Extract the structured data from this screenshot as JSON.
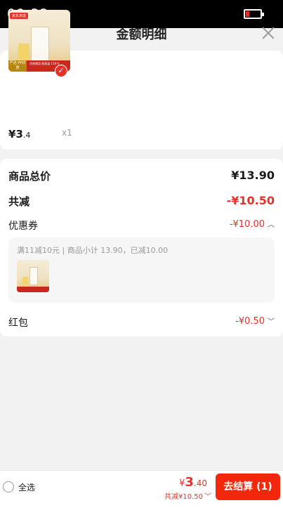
{
  "status_bar": {
    "time": "09:32"
  },
  "header": {
    "title": "金额明细"
  },
  "product": {
    "thumb_tag": "京东京造",
    "thumb_badge_left": "严选 PP材质",
    "thumb_badge_right": "冷热两用 耐高温 110℃",
    "price_symbol": "¥",
    "price_int": "3",
    "price_dec": ".4",
    "quantity": "x1"
  },
  "summary": {
    "total_label": "商品总价",
    "total_value": "¥13.90",
    "reduce_label": "共减",
    "reduce_value": "-¥10.50",
    "coupon_label": "优惠券",
    "coupon_value": "-¥10.00",
    "coupon_desc": "满11减10元 | 商品小计 13.90，已减10.00",
    "redpack_label": "红包",
    "redpack_value": "-¥0.50"
  },
  "bottom": {
    "select_all_label": "全选",
    "price_symbol": "¥",
    "price_int": "3",
    "price_dec": ".40",
    "reduce_text": "共减¥10.50",
    "checkout_label": "去结算 (1)"
  },
  "colors": {
    "accent": "#e4322b",
    "checkout": "#f2270c"
  }
}
